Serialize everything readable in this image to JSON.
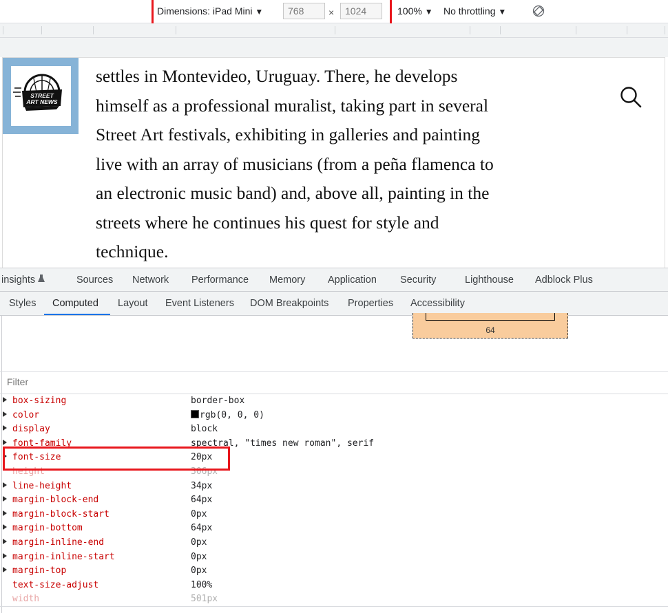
{
  "device_toolbar": {
    "dimensions_label": "Dimensions: iPad Mini",
    "width": "768",
    "height": "1024",
    "times_sign": "×",
    "zoom": "100%",
    "throttling": "No throttling",
    "dropdown_glyph": "▼"
  },
  "page": {
    "logo_alt": "STREET ART NEWS",
    "article_lines": [
      "settles in Montevideo, Uruguay. There, he develops",
      "himself as a professional muralist, taking part in several",
      "Street Art festivals, exhibiting in galleries and painting",
      "live with an array of musicians (from a peña flamenca to",
      "an electronic music band) and, above all, painting in the",
      "streets where he continues his quest for style and",
      "technique."
    ]
  },
  "devtools": {
    "main_tabs": [
      "insights",
      "Sources",
      "Network",
      "Performance",
      "Memory",
      "Application",
      "Security",
      "Lighthouse",
      "Adblock Plus"
    ],
    "sub_tabs": [
      "Styles",
      "Computed",
      "Layout",
      "Event Listeners",
      "DOM Breakpoints",
      "Properties",
      "Accessibility"
    ],
    "active_sub_tab": "Computed",
    "box_model_margin_bottom": "64",
    "filter_placeholder": "Filter",
    "properties": [
      {
        "name": "box-sizing",
        "value": "border-box",
        "expandable": true,
        "inherited": false
      },
      {
        "name": "color",
        "value": "rgb(0, 0, 0)",
        "expandable": true,
        "inherited": false,
        "swatch": "#000000"
      },
      {
        "name": "display",
        "value": "block",
        "expandable": true,
        "inherited": false
      },
      {
        "name": "font-family",
        "value": "spectral, \"times new roman\", serif",
        "expandable": true,
        "inherited": false
      },
      {
        "name": "font-size",
        "value": "20px",
        "expandable": true,
        "inherited": false,
        "highlighted": true
      },
      {
        "name": "height",
        "value": "306px",
        "expandable": false,
        "inherited": true
      },
      {
        "name": "line-height",
        "value": "34px",
        "expandable": true,
        "inherited": false
      },
      {
        "name": "margin-block-end",
        "value": "64px",
        "expandable": true,
        "inherited": false
      },
      {
        "name": "margin-block-start",
        "value": "0px",
        "expandable": true,
        "inherited": false
      },
      {
        "name": "margin-bottom",
        "value": "64px",
        "expandable": true,
        "inherited": false
      },
      {
        "name": "margin-inline-end",
        "value": "0px",
        "expandable": true,
        "inherited": false
      },
      {
        "name": "margin-inline-start",
        "value": "0px",
        "expandable": true,
        "inherited": false
      },
      {
        "name": "margin-top",
        "value": "0px",
        "expandable": true,
        "inherited": false
      },
      {
        "name": "text-size-adjust",
        "value": "100%",
        "expandable": false,
        "inherited": false
      },
      {
        "name": "width",
        "value": "501px",
        "expandable": false,
        "inherited": true
      }
    ]
  },
  "colors": {
    "highlight_box": "#e8161c",
    "logo_frame": "#86b3d7",
    "active_tab_underline": "#1a73e8",
    "property_name": "#c80000",
    "box_model_margin": "#f9cc9d"
  },
  "icons": {
    "rotate": "rotate-icon",
    "search": "search-icon",
    "insights": "flask-icon"
  }
}
